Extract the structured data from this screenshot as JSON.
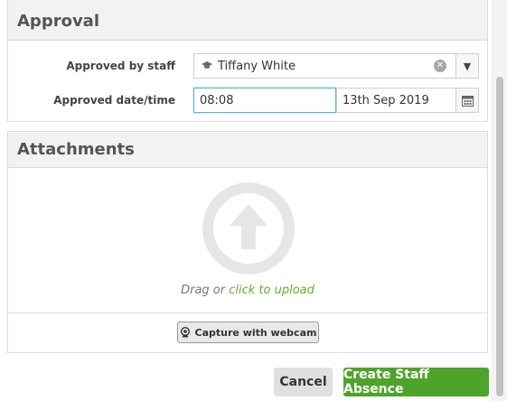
{
  "approval": {
    "title": "Approval",
    "approved_by_label": "Approved by staff",
    "approved_by_value": "Tiffany White",
    "approved_date_label": "Approved date/time",
    "time_value": "08:08",
    "date_value": "13th Sep 2019"
  },
  "attachments": {
    "title": "Attachments",
    "drag_text": "Drag or",
    "upload_link": "click to upload",
    "webcam_label": "Capture with webcam"
  },
  "actions": {
    "cancel_label": "Cancel",
    "create_label": "Create Staff Absence"
  },
  "icons": {
    "graduation_cap": "graduation-cap-icon",
    "clear": "clear-icon",
    "dropdown": "caret-down-icon",
    "calendar": "calendar-icon",
    "upload": "upload-arrow-icon",
    "webcam": "webcam-icon"
  },
  "colors": {
    "primary_green": "#4ea42a",
    "link_green": "#6aab2c",
    "focus_blue": "#5bb7d6"
  }
}
